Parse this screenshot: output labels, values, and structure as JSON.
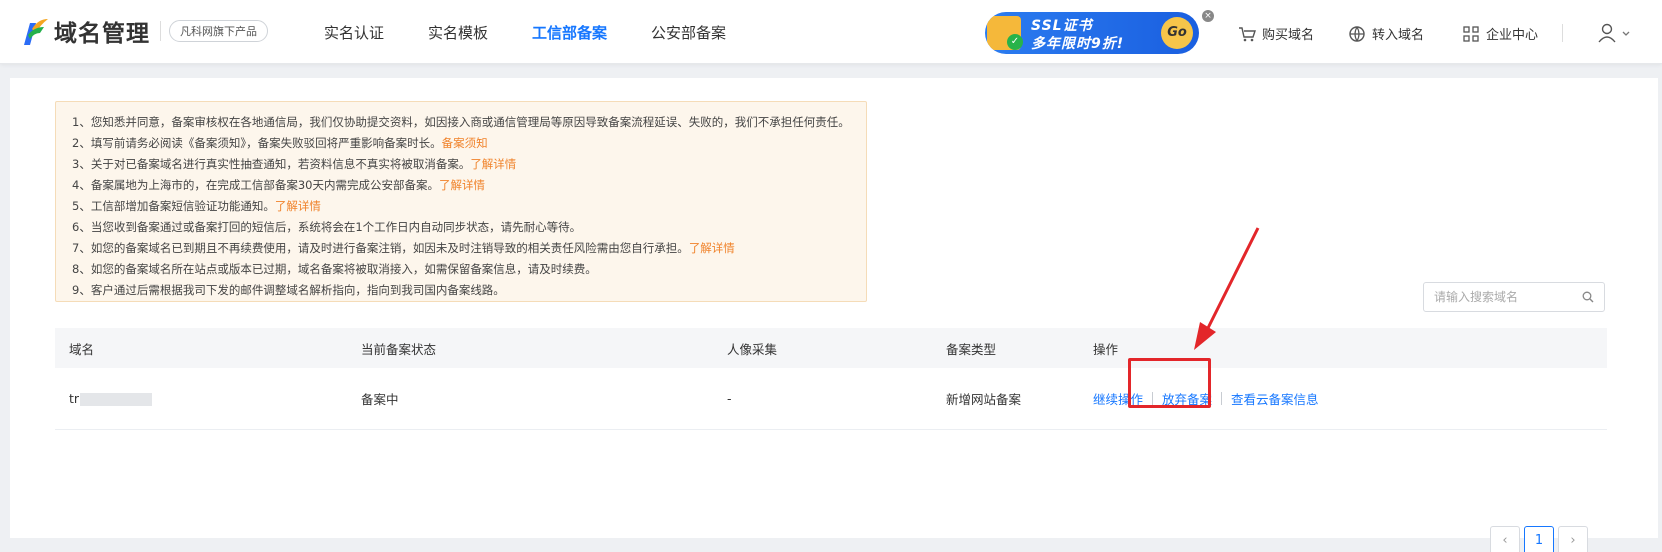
{
  "header": {
    "logo_text": "域名管理",
    "brand_badge": "凡科网旗下产品",
    "nav": [
      {
        "label": "实名认证",
        "active": false
      },
      {
        "label": "实名模板",
        "active": false
      },
      {
        "label": "工信部备案",
        "active": true
      },
      {
        "label": "公安部备案",
        "active": false
      }
    ],
    "promo": {
      "line1": "SSL证书",
      "line2": "多年限时9折!",
      "go": "Go",
      "close": "×"
    },
    "tools": {
      "buy_domain": "购买域名",
      "transfer_domain": "转入域名",
      "enterprise": "企业中心"
    }
  },
  "notice": {
    "lines": [
      {
        "text": "1、您知悉并同意，备案审核权在各地通信局，我们仅协助提交资料，如因接入商或通信管理局等原因导致备案流程延误、失败的，我们不承担任何责任。",
        "link": ""
      },
      {
        "text": "2、填写前请务必阅读《备案须知》，备案失败驳回将严重影响备案时长。",
        "link": "备案须知"
      },
      {
        "text": "3、关于对已备案域名进行真实性抽查通知，若资料信息不真实将被取消备案。",
        "link": "了解详情"
      },
      {
        "text": "4、备案属地为上海市的，在完成工信部备案30天内需完成公安部备案。",
        "link": "了解详情"
      },
      {
        "text": "5、工信部增加备案短信验证功能通知。",
        "link": "了解详情"
      },
      {
        "text": "6、当您收到备案通过或备案打回的短信后，系统将会在1个工作日内自动同步状态，请先耐心等待。",
        "link": ""
      },
      {
        "text": "7、如您的备案域名已到期且不再续费使用，请及时进行备案注销，如因未及时注销导致的相关责任风险需由您自行承担。",
        "link": "了解详情"
      },
      {
        "text": "8、如您的备案域名所在站点或版本已过期，域名备案将被取消接入，如需保留备案信息，请及时续费。",
        "link": ""
      },
      {
        "text": "9、客户通过后需根据我司下发的邮件调整域名解析指向，指向到我司国内备案线路。",
        "link": ""
      }
    ]
  },
  "search": {
    "placeholder": "请输入搜索域名",
    "value": ""
  },
  "table": {
    "headers": {
      "domain": "域名",
      "status": "当前备案状态",
      "face": "人像采集",
      "type": "备案类型",
      "ops": "操作"
    },
    "rows": [
      {
        "domain_prefix": "tr",
        "status": "备案中",
        "face": "-",
        "type": "新增网站备案",
        "ops": {
          "continue": "继续操作",
          "abandon": "放弃备案",
          "view": "查看云备案信息"
        }
      }
    ]
  },
  "pagination": {
    "prev": "‹",
    "current": "1",
    "next": "›"
  },
  "colors": {
    "accent": "#1677ff",
    "notice_bg": "#fdf6ec",
    "link_orange": "#f0822a",
    "annotation_red": "#e3262a"
  }
}
